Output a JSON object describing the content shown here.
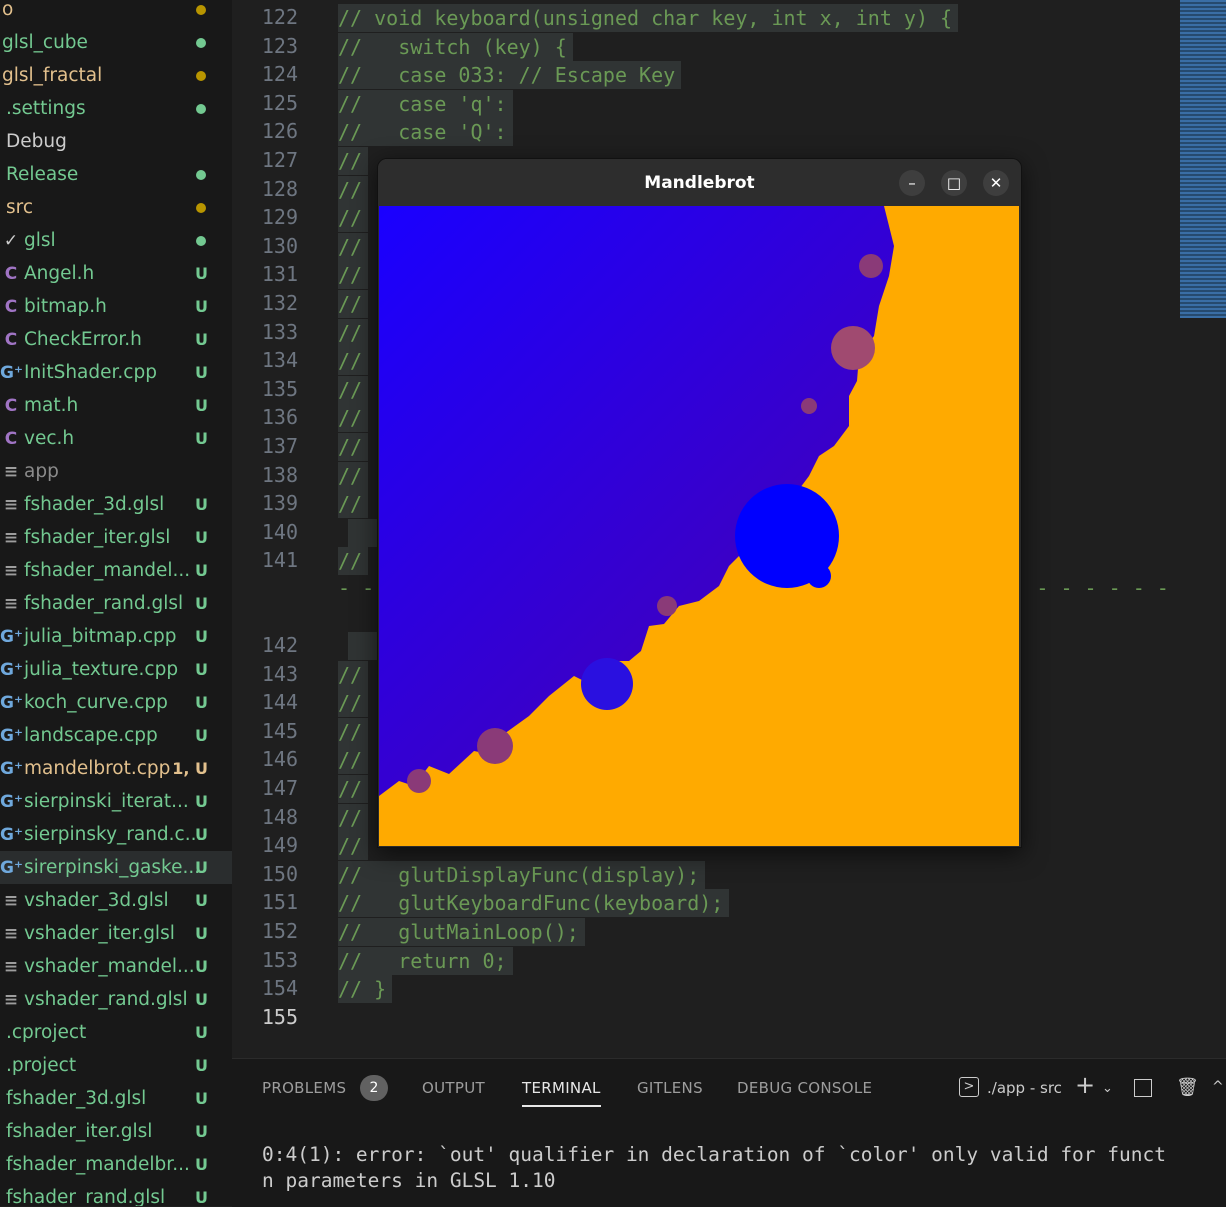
{
  "explorer": {
    "items": [
      {
        "label": "o",
        "status": "",
        "dot": "#b89500",
        "color": "#e2c08d",
        "icon": "",
        "indent": 0
      },
      {
        "label": "glsl_cube",
        "status": "",
        "dot": "#73c991",
        "color": "#73c991",
        "icon": "",
        "indent": 0
      },
      {
        "label": "glsl_fractal",
        "status": "",
        "dot": "#b89500",
        "color": "#e2c08d",
        "icon": "",
        "indent": 0
      },
      {
        "label": ".settings",
        "status": "",
        "dot": "#73c991",
        "color": "#73c991",
        "icon": "",
        "indent": 4
      },
      {
        "label": "Debug",
        "status": "",
        "dot": "",
        "color": "#cccccc",
        "icon": "",
        "indent": 4
      },
      {
        "label": "Release",
        "status": "",
        "dot": "#73c991",
        "color": "#73c991",
        "icon": "",
        "indent": 4
      },
      {
        "label": "src",
        "status": "",
        "dot": "#b89500",
        "color": "#e2c08d",
        "icon": "",
        "indent": 4
      },
      {
        "label": "glsl",
        "status": "",
        "dot": "#73c991",
        "color": "#73c991",
        "icon": "chevron-down-icon",
        "indent": 0
      },
      {
        "label": "Angel.h",
        "status": "U",
        "dot": "",
        "color": "#73c991",
        "icon": "c-header-icon",
        "indent": 4
      },
      {
        "label": "bitmap.h",
        "status": "U",
        "dot": "",
        "color": "#73c991",
        "icon": "c-header-icon",
        "indent": 4
      },
      {
        "label": "CheckError.h",
        "status": "U",
        "dot": "",
        "color": "#73c991",
        "icon": "c-header-icon",
        "indent": 4
      },
      {
        "label": "InitShader.cpp",
        "status": "U",
        "dot": "",
        "color": "#73c991",
        "icon": "cpp-file-icon",
        "indent": 4
      },
      {
        "label": "mat.h",
        "status": "U",
        "dot": "",
        "color": "#73c991",
        "icon": "c-header-icon",
        "indent": 4
      },
      {
        "label": "vec.h",
        "status": "U",
        "dot": "",
        "color": "#73c991",
        "icon": "c-header-icon",
        "indent": 4
      },
      {
        "label": "app",
        "status": "",
        "dot": "",
        "color": "#8b8b8b",
        "icon": "file-lines-icon",
        "indent": 0
      },
      {
        "label": "fshader_3d.glsl",
        "status": "U",
        "dot": "",
        "color": "#73c991",
        "icon": "file-lines-icon",
        "indent": 0
      },
      {
        "label": "fshader_iter.glsl",
        "status": "U",
        "dot": "",
        "color": "#73c991",
        "icon": "file-lines-icon",
        "indent": 0
      },
      {
        "label": "fshader_mandel...",
        "status": "U",
        "dot": "",
        "color": "#73c991",
        "icon": "file-lines-icon",
        "indent": 0
      },
      {
        "label": "fshader_rand.glsl",
        "status": "U",
        "dot": "",
        "color": "#73c991",
        "icon": "file-lines-icon",
        "indent": 0
      },
      {
        "label": "julia_bitmap.cpp",
        "status": "U",
        "dot": "",
        "color": "#73c991",
        "icon": "cpp-file-icon",
        "indent": 0
      },
      {
        "label": "julia_texture.cpp",
        "status": "U",
        "dot": "",
        "color": "#73c991",
        "icon": "cpp-file-icon",
        "indent": 0
      },
      {
        "label": "koch_curve.cpp",
        "status": "U",
        "dot": "",
        "color": "#73c991",
        "icon": "cpp-file-icon",
        "indent": 0
      },
      {
        "label": "landscape.cpp",
        "status": "U",
        "dot": "",
        "color": "#73c991",
        "icon": "cpp-file-icon",
        "indent": 0
      },
      {
        "label": "mandelbrot.cpp",
        "status": "1, U",
        "dot": "",
        "color": "#e2c08d",
        "icon": "cpp-file-icon",
        "indent": 0
      },
      {
        "label": "sierpinski_iterat...",
        "status": "U",
        "dot": "",
        "color": "#73c991",
        "icon": "cpp-file-icon",
        "indent": 0
      },
      {
        "label": "sierpinsky_rand.c...",
        "status": "U",
        "dot": "",
        "color": "#73c991",
        "icon": "cpp-file-icon",
        "indent": 0
      },
      {
        "label": "sirerpinski_gaske...",
        "status": "U",
        "dot": "",
        "color": "#73c991",
        "icon": "cpp-file-icon",
        "indent": 0,
        "active": true
      },
      {
        "label": "vshader_3d.glsl",
        "status": "U",
        "dot": "",
        "color": "#73c991",
        "icon": "file-lines-icon",
        "indent": 0
      },
      {
        "label": "vshader_iter.glsl",
        "status": "U",
        "dot": "",
        "color": "#73c991",
        "icon": "file-lines-icon",
        "indent": 0
      },
      {
        "label": "vshader_mandel...",
        "status": "U",
        "dot": "",
        "color": "#73c991",
        "icon": "file-lines-icon",
        "indent": 0
      },
      {
        "label": "vshader_rand.glsl",
        "status": "U",
        "dot": "",
        "color": "#73c991",
        "icon": "file-lines-icon",
        "indent": 0
      },
      {
        "label": ".cproject",
        "status": "U",
        "dot": "",
        "color": "#73c991",
        "icon": "",
        "indent": 4
      },
      {
        "label": ".project",
        "status": "U",
        "dot": "",
        "color": "#73c991",
        "icon": "",
        "indent": 4
      },
      {
        "label": "fshader_3d.glsl",
        "status": "U",
        "dot": "",
        "color": "#73c991",
        "icon": "",
        "indent": 4
      },
      {
        "label": "fshader_iter.glsl",
        "status": "U",
        "dot": "",
        "color": "#73c991",
        "icon": "",
        "indent": 4
      },
      {
        "label": "fshader_mandelbr...",
        "status": "U",
        "dot": "",
        "color": "#73c991",
        "icon": "",
        "indent": 4
      },
      {
        "label": "fshader_rand.glsl",
        "status": "U",
        "dot": "",
        "color": "#73c991",
        "icon": "",
        "indent": 4
      }
    ]
  },
  "editor": {
    "current_line": "155",
    "lines": [
      {
        "n": "122",
        "text": "// void keyboard(unsigned char key, int x, int y) {"
      },
      {
        "n": "123",
        "text": "//   switch (key) {"
      },
      {
        "n": "124",
        "text": "//   case 033: // Escape Key"
      },
      {
        "n": "125",
        "text": "//   case 'q':"
      },
      {
        "n": "126",
        "text": "//   case 'Q':"
      },
      {
        "n": "127",
        "text": "//"
      },
      {
        "n": "128",
        "text": "//"
      },
      {
        "n": "129",
        "text": "//"
      },
      {
        "n": "130",
        "text": "//"
      },
      {
        "n": "131",
        "text": "//"
      },
      {
        "n": "132",
        "text": "//"
      },
      {
        "n": "133",
        "text": "//"
      },
      {
        "n": "134",
        "text": "//"
      },
      {
        "n": "135",
        "text": "//"
      },
      {
        "n": "136",
        "text": "//"
      },
      {
        "n": "137",
        "text": "//"
      },
      {
        "n": "138",
        "text": "//"
      },
      {
        "n": "139",
        "text": "//"
      },
      {
        "n": "140",
        "text": ""
      },
      {
        "n": "141",
        "text": "//"
      },
      {
        "n": "142",
        "text": ""
      },
      {
        "n": "143",
        "text": "//"
      },
      {
        "n": "144",
        "text": "//"
      },
      {
        "n": "145",
        "text": "//"
      },
      {
        "n": "146",
        "text": "//"
      },
      {
        "n": "147",
        "text": "//"
      },
      {
        "n": "148",
        "text": "//"
      },
      {
        "n": "149",
        "text": "//"
      },
      {
        "n": "150",
        "text": "//   glutDisplayFunc(display);"
      },
      {
        "n": "151",
        "text": "//   glutKeyboardFunc(keyboard);"
      },
      {
        "n": "152",
        "text": "//   glutMainLoop();"
      },
      {
        "n": "153",
        "text": "//   return 0;"
      },
      {
        "n": "154",
        "text": "// }"
      },
      {
        "n": "155",
        "text": ""
      }
    ],
    "dash_line": "- - - - - - - - - - - - - - - - - - - - - - - - - - - - - - - - - - -"
  },
  "app_window": {
    "title": "Mandlebrot",
    "minimize_symbol": "–",
    "maximize_symbol": "□",
    "close_symbol": "✕",
    "colors": {
      "inside": "#0000ff",
      "outside": "#ffaa00",
      "gradient": "#2a00d8",
      "bulb": "#a04a70"
    }
  },
  "panel": {
    "tabs": [
      "PROBLEMS",
      "OUTPUT",
      "TERMINAL",
      "GITLENS",
      "DEBUG CONSOLE"
    ],
    "active_tab": "TERMINAL",
    "problems_count": "2",
    "terminal_name": "./app - src",
    "terminal_output": [
      "0:4(1): error: `out' qualifier in declaration of `color' only valid for funct",
      "n parameters in GLSL 1.10"
    ]
  }
}
